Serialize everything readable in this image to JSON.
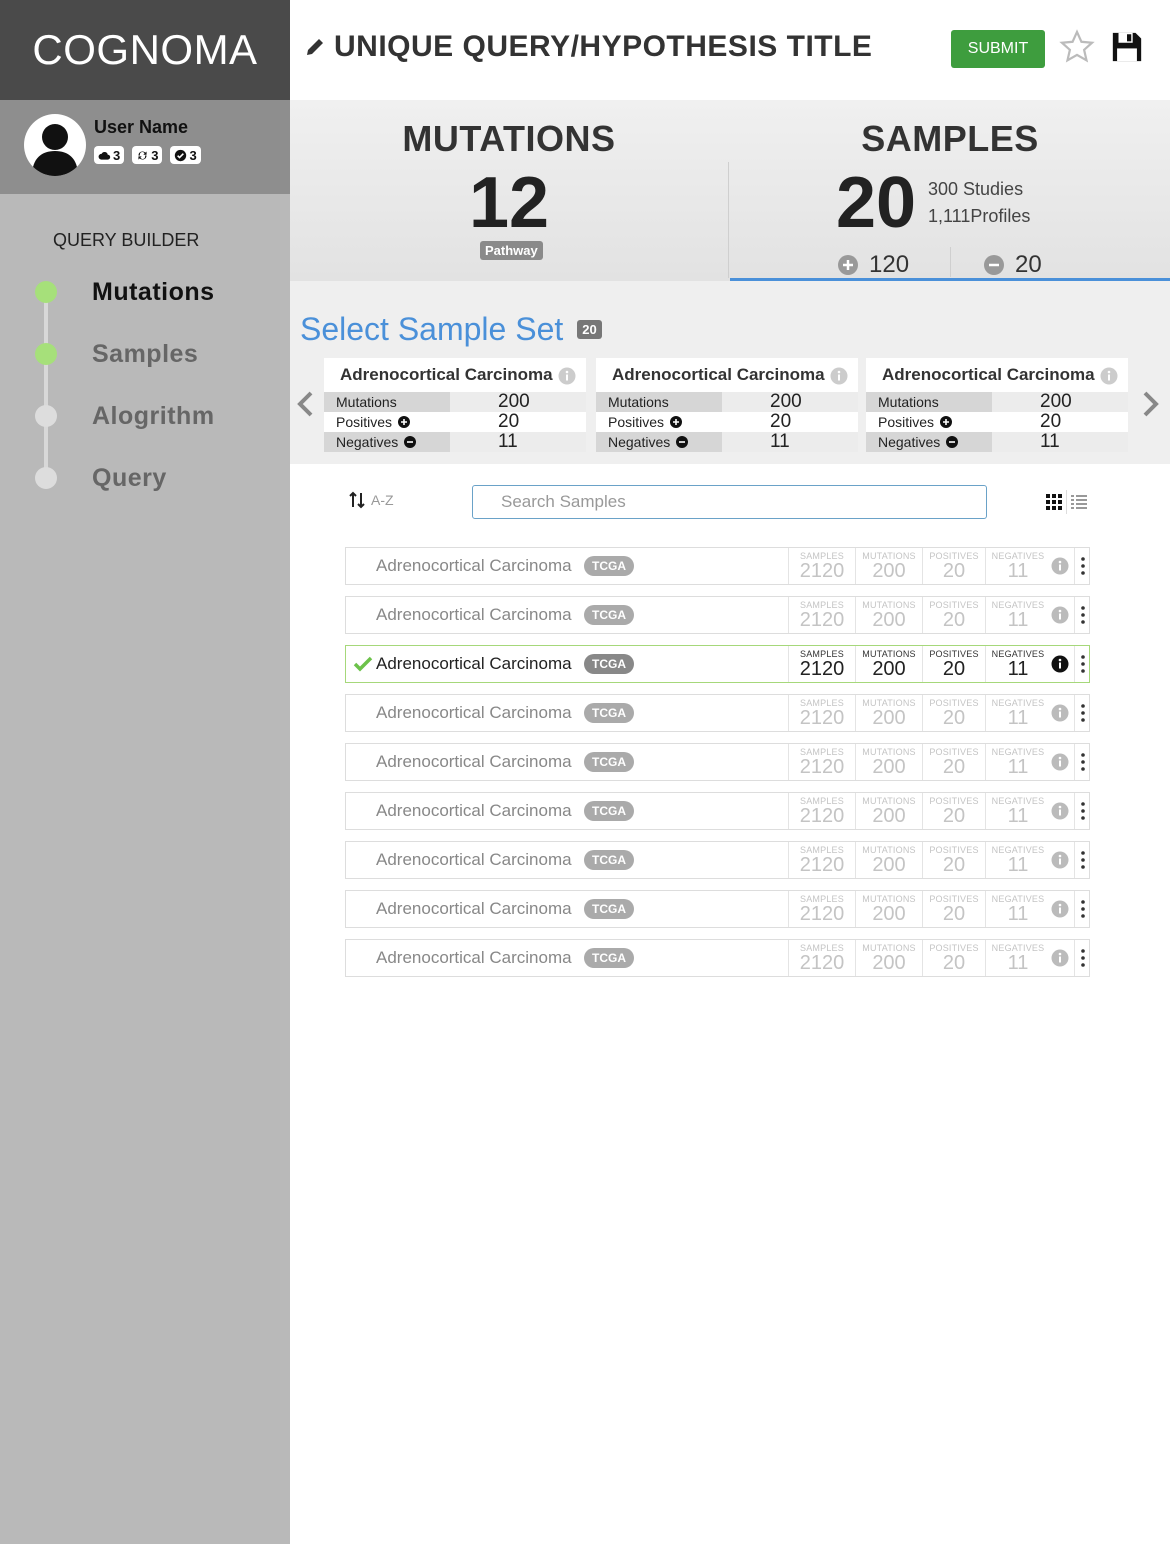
{
  "app": {
    "logo": "COGNOMA"
  },
  "user": {
    "name": "User Name",
    "badges": [
      {
        "icon": "cloud-icon",
        "count": "3"
      },
      {
        "icon": "refresh-icon",
        "count": "3"
      },
      {
        "icon": "check-circle-icon",
        "count": "3"
      }
    ]
  },
  "query_builder": {
    "title": "QUERY BUILDER",
    "steps": [
      {
        "label": "Mutations",
        "done": true,
        "active": true
      },
      {
        "label": "Samples",
        "done": true,
        "active": false
      },
      {
        "label": "Alogrithm",
        "done": false,
        "active": false
      },
      {
        "label": "Query",
        "done": false,
        "active": false
      }
    ]
  },
  "header": {
    "title": "UNIQUE QUERY/HYPOTHESIS TITLE",
    "submit_label": "SUBMIT"
  },
  "stats": {
    "mutations": {
      "title": "MUTATIONS",
      "value": "12",
      "badge": "Pathway"
    },
    "samples": {
      "title": "SAMPLES",
      "value": "20",
      "studies": "300 Studies",
      "profiles": "1,111Profiles",
      "positive": "120",
      "negative": "20"
    }
  },
  "sample_set": {
    "title": "Select Sample Set",
    "count": "20",
    "cards": [
      {
        "title": "Adrenocortical Carcinoma",
        "mutations_label": "Mutations",
        "mutations": "200",
        "positives_label": "Positives",
        "positives": "20",
        "negatives_label": "Negatives",
        "negatives": "11"
      },
      {
        "title": "Adrenocortical Carcinoma",
        "mutations_label": "Mutations",
        "mutations": "200",
        "positives_label": "Positives",
        "positives": "20",
        "negatives_label": "Negatives",
        "negatives": "11"
      },
      {
        "title": "Adrenocortical Carcinoma",
        "mutations_label": "Mutations",
        "mutations": "200",
        "positives_label": "Positives",
        "positives": "20",
        "negatives_label": "Negatives",
        "negatives": "11"
      }
    ]
  },
  "list": {
    "sort_label": "A-Z",
    "search_placeholder": "Search Samples",
    "metric_labels": {
      "samples": "SAMPLES",
      "mutations": "MUTATIONS",
      "positives": "POSITIVES",
      "negatives": "NEGATIVES"
    },
    "rows": [
      {
        "name": "Adrenocortical Carcinoma",
        "tag": "TCGA",
        "samples": "2120",
        "mutations": "200",
        "positives": "20",
        "negatives": "11",
        "selected": false
      },
      {
        "name": "Adrenocortical Carcinoma",
        "tag": "TCGA",
        "samples": "2120",
        "mutations": "200",
        "positives": "20",
        "negatives": "11",
        "selected": false
      },
      {
        "name": "Adrenocortical Carcinoma",
        "tag": "TCGA",
        "samples": "2120",
        "mutations": "200",
        "positives": "20",
        "negatives": "11",
        "selected": true
      },
      {
        "name": "Adrenocortical Carcinoma",
        "tag": "TCGA",
        "samples": "2120",
        "mutations": "200",
        "positives": "20",
        "negatives": "11",
        "selected": false
      },
      {
        "name": "Adrenocortical Carcinoma",
        "tag": "TCGA",
        "samples": "2120",
        "mutations": "200",
        "positives": "20",
        "negatives": "11",
        "selected": false
      },
      {
        "name": "Adrenocortical Carcinoma",
        "tag": "TCGA",
        "samples": "2120",
        "mutations": "200",
        "positives": "20",
        "negatives": "11",
        "selected": false
      },
      {
        "name": "Adrenocortical Carcinoma",
        "tag": "TCGA",
        "samples": "2120",
        "mutations": "200",
        "positives": "20",
        "negatives": "11",
        "selected": false
      },
      {
        "name": "Adrenocortical Carcinoma",
        "tag": "TCGA",
        "samples": "2120",
        "mutations": "200",
        "positives": "20",
        "negatives": "11",
        "selected": false
      },
      {
        "name": "Adrenocortical Carcinoma",
        "tag": "TCGA",
        "samples": "2120",
        "mutations": "200",
        "positives": "20",
        "negatives": "11",
        "selected": false
      }
    ]
  },
  "colors": {
    "accent_blue": "#4a90d9",
    "submit_green": "#3e9d3e",
    "step_done": "#a6e07a",
    "sidebar": "#b9b9b9"
  }
}
